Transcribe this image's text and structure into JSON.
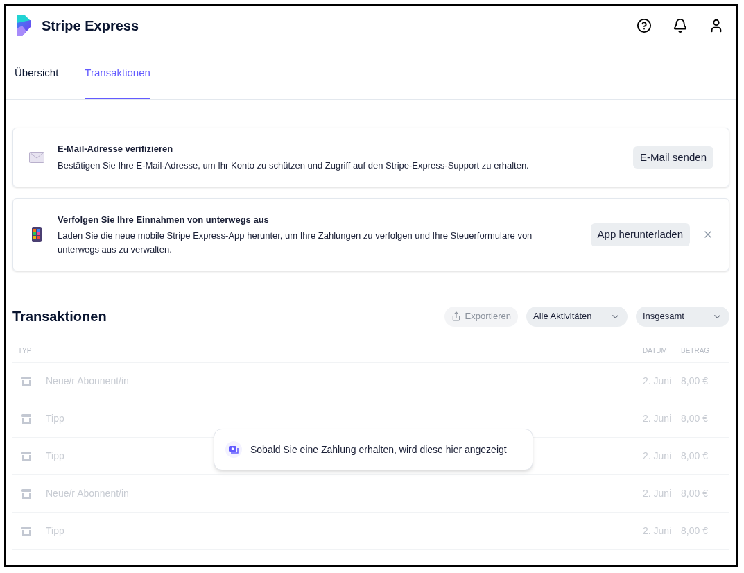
{
  "app": {
    "title": "Stripe Express"
  },
  "tabs": [
    {
      "label": "Übersicht",
      "selected": false
    },
    {
      "label": "Transaktionen",
      "selected": true
    }
  ],
  "notices": [
    {
      "kind": "email",
      "title": "E-Mail-Adresse verifizieren",
      "text": "Bestätigen Sie Ihre E-Mail-Adresse, um Ihr Konto zu schützen und Zugriff auf den Stripe-Express-Support zu erhalten.",
      "action": "E-Mail senden",
      "dismissible": false
    },
    {
      "kind": "phone",
      "title": "Verfolgen Sie Ihre Einnahmen von unterwegs aus",
      "text": "Laden Sie die neue mobile Stripe Express-App herunter, um Ihre Zahlungen zu verfolgen und Ihre Steuerformulare von unterwegs aus zu verwalten.",
      "action": "App herunterladen",
      "dismissible": true
    }
  ],
  "transactions": {
    "title": "Transaktionen",
    "export": {
      "label": "Exportieren",
      "disabled": true
    },
    "filters": [
      "Alle Aktivitäten",
      "Insgesamt"
    ],
    "columns": [
      "TYP",
      "DATUM",
      "BETRAG"
    ],
    "rows": [
      {
        "type": "Neue/r Abonnent/in",
        "date": "2. Juni",
        "amount": "8,00 €",
        "disabled": true
      },
      {
        "type": "Tipp",
        "date": "2. Juni",
        "amount": "8,00 €",
        "disabled": true
      },
      {
        "type": "Tipp",
        "date": "2. Juni",
        "amount": "8,00 €",
        "disabled": true
      },
      {
        "type": "Neue/r Abonnent/in",
        "date": "2. Juni",
        "amount": "8,00 €",
        "disabled": true
      },
      {
        "type": "Tipp",
        "date": "2. Juni",
        "amount": "8,00 €",
        "disabled": true
      }
    ],
    "empty_message": "Sobald Sie eine Zahlung erhalten, wird diese hier angezeigt"
  }
}
